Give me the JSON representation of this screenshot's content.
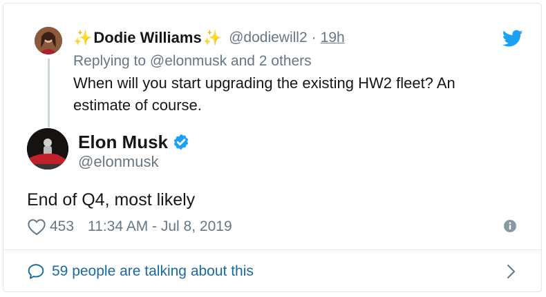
{
  "parent": {
    "sparkle_left": "✨",
    "name": "Dodie Williams",
    "sparkle_right": "✨",
    "handle": "@dodiewill2",
    "separator": "·",
    "time": "19h",
    "replying_to": "Replying to @elonmusk and 2 others",
    "text": "When will you start upgrading the existing HW2 fleet? An estimate of course."
  },
  "main": {
    "name": "Elon Musk",
    "handle": "@elonmusk",
    "text": "End of Q4, most likely",
    "likes": "453",
    "timestamp": "11:34 AM - Jul 8, 2019"
  },
  "footer": {
    "talking_text": "59 people are talking about this"
  },
  "colors": {
    "twitter_blue": "#1da1f2",
    "verified_blue": "#1da1f2",
    "link_blue": "#1b6a9c",
    "secondary_text": "#657786"
  },
  "icons": [
    "twitter-bird-icon",
    "verified-badge-icon",
    "heart-icon",
    "info-icon",
    "speech-bubble-icon",
    "chevron-right-icon"
  ]
}
